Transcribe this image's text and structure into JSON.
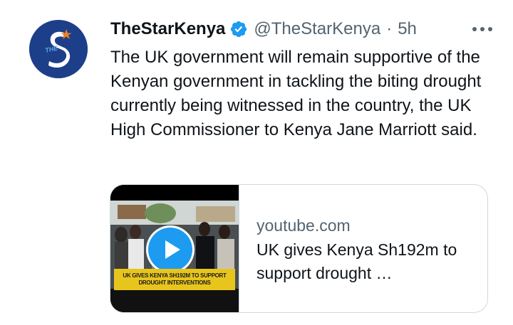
{
  "tweet": {
    "display_name": "TheStarKenya",
    "verified_icon": "verified-badge-icon",
    "handle": "@TheStarKenya",
    "separator": "·",
    "time": "5h",
    "text": "The UK government will remain supportive of the Kenyan government in tackling the biting drought currently being witnessed in the country, the UK High Commissioner to Kenya Jane Marriott said.",
    "avatar": {
      "logo_letter": "S",
      "logo_prefix": "THE",
      "bg_color": "#1d3f8a",
      "accent": "#f07f1d"
    },
    "more_icon": "more-horizontal-icon"
  },
  "card": {
    "domain": "youtube.com",
    "title": "UK gives Kenya Sh192m to support drought …",
    "thumbnail_banner_line1": "UK GIVES KENYA SH192M TO SUPPORT",
    "thumbnail_banner_line2": "DROUGHT INTERVENTIONS",
    "play_icon": "play-icon",
    "banner_color": "#e8c51d",
    "play_color": "#1d9bf0"
  },
  "colors": {
    "text_primary": "#0f1419",
    "text_secondary": "#536471",
    "border": "#cfd9de",
    "verified": "#1d9bf0"
  }
}
